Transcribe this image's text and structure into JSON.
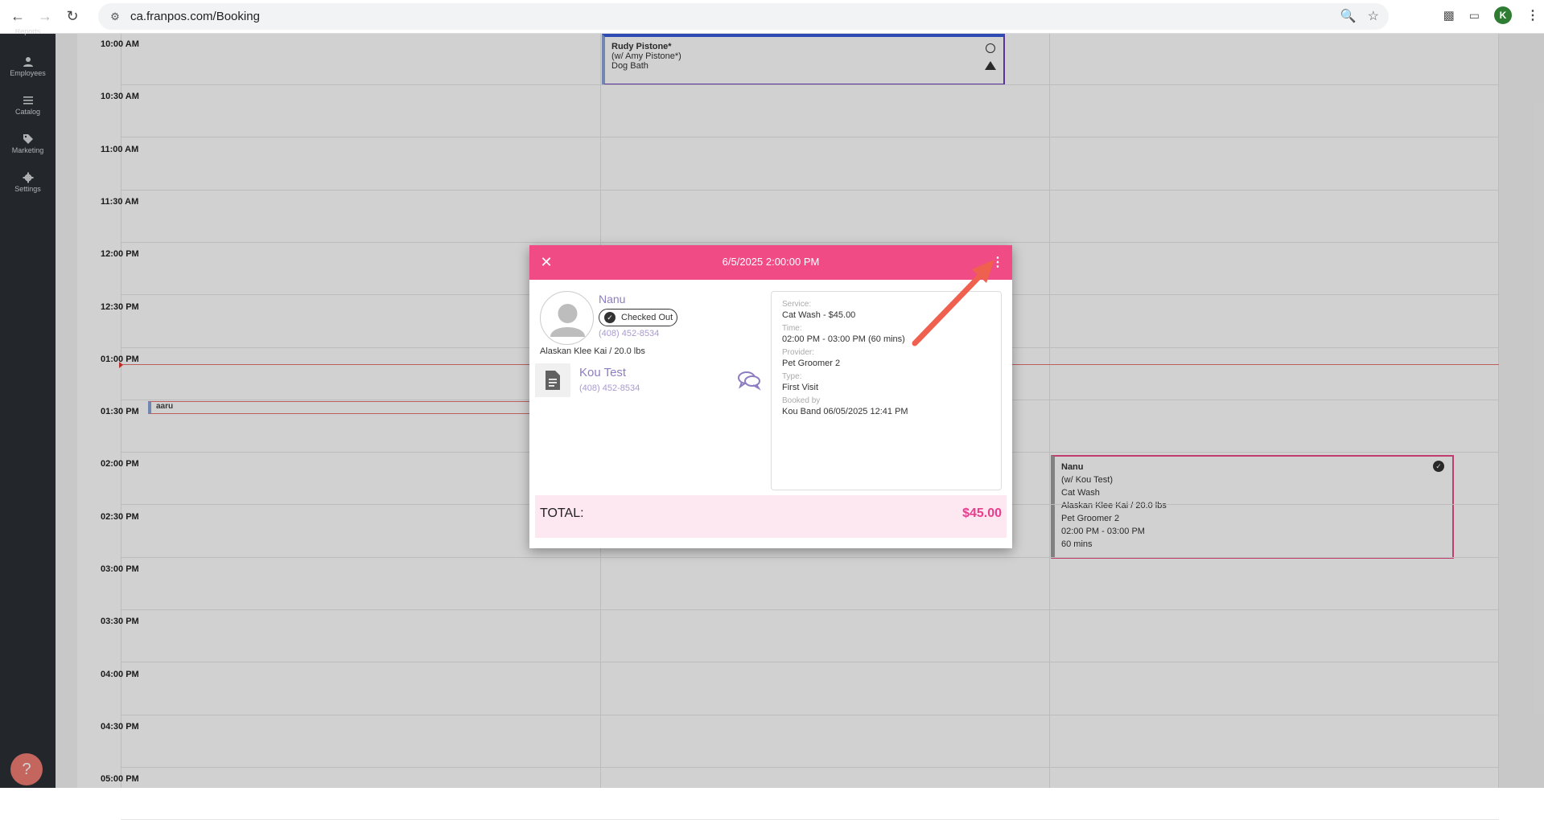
{
  "browser": {
    "url": "ca.franpos.com/Booking",
    "profile_initial": "K"
  },
  "sidebar": {
    "items": [
      {
        "label": "Reports",
        "icon": "reports-icon"
      },
      {
        "label": "Employees",
        "icon": "person-icon"
      },
      {
        "label": "Catalog",
        "icon": "list-icon"
      },
      {
        "label": "Marketing",
        "icon": "tag-icon"
      },
      {
        "label": "Settings",
        "icon": "gear-icon"
      }
    ],
    "help_label": "?"
  },
  "calendar": {
    "times": [
      "10:00 AM",
      "10:30 AM",
      "11:00 AM",
      "11:30 AM",
      "12:00 PM",
      "12:30 PM",
      "01:00 PM",
      "01:30 PM",
      "02:00 PM",
      "02:30 PM",
      "03:00 PM",
      "03:30 PM",
      "04:00 PM",
      "04:30 PM",
      "05:00 PM"
    ],
    "appointments": {
      "rudy": {
        "name": "Rudy Pistone*",
        "with": "(w/ Amy Pistone*)",
        "service": "Dog Bath"
      },
      "aaru": {
        "name": "aaru"
      },
      "nanu": {
        "name": "Nanu",
        "with": "(w/ Kou Test)",
        "service": "Cat Wash",
        "breed": "Alaskan Klee Kai / 20.0 lbs",
        "provider": "Pet Groomer 2",
        "time": "02:00 PM - 03:00 PM",
        "duration": "60 mins"
      }
    }
  },
  "modal": {
    "title": "6/5/2025 2:00:00 PM",
    "pet": {
      "name": "Nanu",
      "status": "Checked Out",
      "phone": "(408) 452-8534",
      "breed": "Alaskan Klee Kai / 20.0 lbs"
    },
    "owner": {
      "name": "Kou Test",
      "phone": "(408) 452-8534"
    },
    "details": {
      "service_label": "Service:",
      "service": "Cat Wash - $45.00",
      "time_label": "Time:",
      "time": "02:00 PM - 03:00 PM (60 mins)",
      "provider_label": "Provider:",
      "provider": "Pet Groomer 2",
      "type_label": "Type:",
      "type": "First Visit",
      "booked_label": "Booked by",
      "booked": "Kou Band 06/05/2025 12:41 PM"
    },
    "total_label": "TOTAL:",
    "total_value": "$45.00"
  },
  "colors": {
    "modal_header": "#f14b86",
    "sidebar": "#2b3036",
    "accent_purple": "#8e7cc3",
    "annotation_arrow": "#f0604f"
  }
}
